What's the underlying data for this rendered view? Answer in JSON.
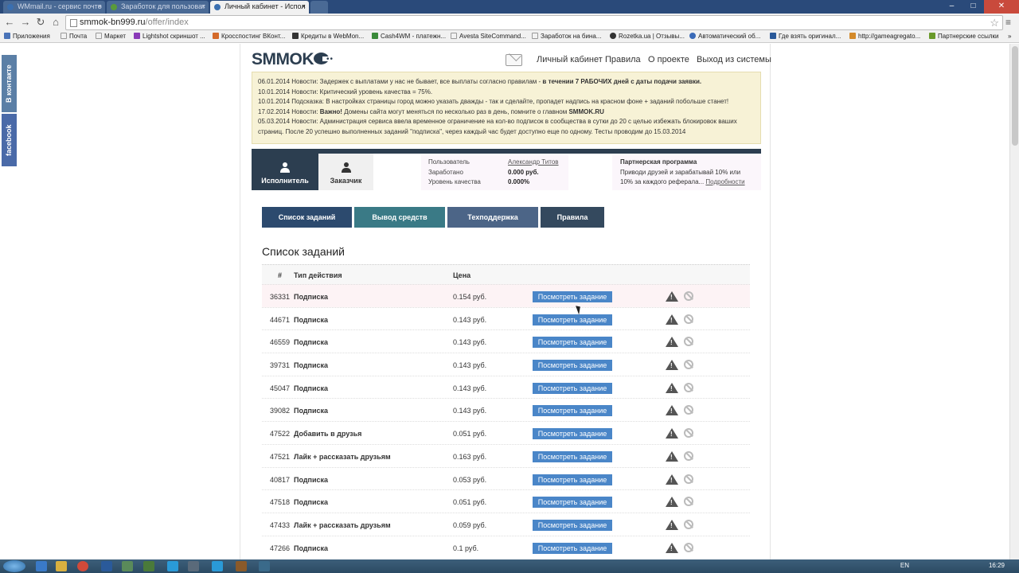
{
  "browser": {
    "tabs": [
      {
        "label": "WMmail.ru - сервис почто",
        "active": false
      },
      {
        "label": "Заработок для пользоват",
        "active": false
      },
      {
        "label": "Личный кабинет - Испол",
        "active": true
      }
    ],
    "url_host": "smmok-bn999.ru",
    "url_path": "/offer/index",
    "bookmarks": [
      "Приложения",
      "Почта",
      "Маркет",
      "Lightshot скриншот ...",
      "Кросспостинг ВКонт...",
      "Кредиты в WebMon...",
      "Cash4WM - платежн...",
      "Avesta SiteCommand...",
      "Заработок на бина...",
      "Rozetka.ua | Отзывы...",
      "Автоматический об...",
      "Где взять оригинал...",
      "http://gameagregato...",
      "Партнерские ссылки"
    ]
  },
  "social": {
    "vk": "В контакте",
    "fb": "facebook"
  },
  "site": {
    "logo": "SMMOK",
    "nav": [
      "Личный кабинет",
      "Правила",
      "О проекте",
      "Выход из системы"
    ]
  },
  "news": [
    {
      "pre": "06.01.2014 Новости: Задержек с выплатами у нас не бывает, все выплаты согласно правилам - ",
      "bold": "в течении 7 РАБОЧИХ дней с даты подачи заявки.",
      "post": ""
    },
    {
      "pre": "10.01.2014 Новости: Критический уровень качества = 75%.",
      "bold": "",
      "post": ""
    },
    {
      "pre": "10.01.2014 Подсказка: В настройках страницы город можно указать дважды - так и сделайте, пропадет надпись на красном фоне + заданий побольше станет!",
      "bold": "",
      "post": ""
    },
    {
      "pre": "17.02.2014 Новости: ",
      "bold": "Важно!",
      "post": " Домены сайта могут меняться по несколько раз в день, помните о главном "
    },
    {
      "pre": "05.03.2014 Новости: Администрация сервиса ввела временное ограничение на кол-во подписок в сообщества в сутки до 20 с целью избежать блокировок ваших страниц. После 20 успешно выполненных заданий \"подписка\", через каждый час будет доступно еще по одному. Тесты проводим до 15.03.2014",
      "bold": "",
      "post": ""
    }
  ],
  "news_domain": "SMMOK.RU",
  "roles": {
    "executor": "Исполнитель",
    "customer": "Заказчик"
  },
  "user": {
    "user_label": "Пользователь",
    "user_value": "Александр Титов",
    "earned_label": "Заработано",
    "earned_value": "0.000 руб.",
    "quality_label": "Уровень качества",
    "quality_value": "0.000%"
  },
  "partner": {
    "title": "Партнерская программа",
    "text": "Приводи друзей и зарабатывай 10% или 10% за каждого реферала... ",
    "link": "Подробности"
  },
  "menu": [
    {
      "label": "Список заданий",
      "color": "#2c4a6e"
    },
    {
      "label": "Вывод средств",
      "color": "#3a7a86"
    },
    {
      "label": "Техподдержка",
      "color": "#4c6587"
    },
    {
      "label": "Правила",
      "color": "#34495e"
    }
  ],
  "page_title": "Список заданий",
  "table": {
    "headers": {
      "num": "#",
      "type": "Тип действия",
      "price": "Цена"
    },
    "button_label": "Посмотреть задание",
    "rows": [
      {
        "num": "36331",
        "type": "Подписка",
        "price": "0.154 руб."
      },
      {
        "num": "44671",
        "type": "Подписка",
        "price": "0.143 руб."
      },
      {
        "num": "46559",
        "type": "Подписка",
        "price": "0.143 руб."
      },
      {
        "num": "39731",
        "type": "Подписка",
        "price": "0.143 руб."
      },
      {
        "num": "45047",
        "type": "Подписка",
        "price": "0.143 руб."
      },
      {
        "num": "39082",
        "type": "Подписка",
        "price": "0.143 руб."
      },
      {
        "num": "47522",
        "type": "Добавить в друзья",
        "price": "0.051 руб."
      },
      {
        "num": "47521",
        "type": "Лайк + рассказать друзьям",
        "price": "0.163 руб."
      },
      {
        "num": "40817",
        "type": "Подписка",
        "price": "0.053 руб."
      },
      {
        "num": "47518",
        "type": "Подписка",
        "price": "0.051 руб."
      },
      {
        "num": "47433",
        "type": "Лайк + рассказать друзьям",
        "price": "0.059 руб."
      },
      {
        "num": "47266",
        "type": "Подписка",
        "price": "0.1 руб."
      }
    ]
  },
  "taskbar": {
    "lang": "EN",
    "clock": "16:29"
  }
}
